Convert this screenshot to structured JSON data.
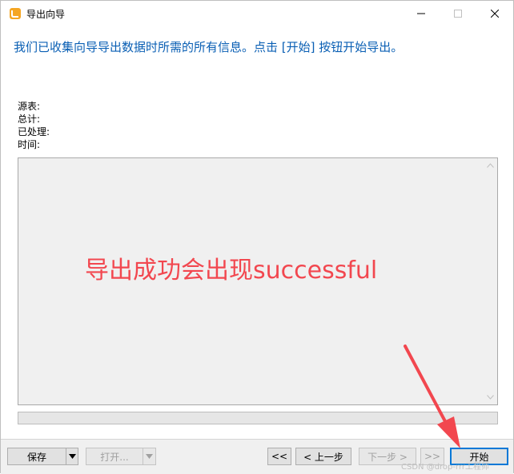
{
  "window": {
    "title": "导出向导",
    "controls": {
      "minimize": "minimize",
      "maximize": "maximize",
      "close": "close"
    }
  },
  "main": {
    "heading": "我们已收集向导导出数据时所需的所有信息。点击 [开始] 按钮开始导出。",
    "info_labels": [
      "源表:",
      "总计:",
      "已处理:",
      "时间:"
    ],
    "log_text": "导出成功会出现successful",
    "progress": 0
  },
  "footer": {
    "save_label": "保存",
    "open_label": "打开...",
    "first_label": "<<",
    "prev_label": "< 上一步",
    "next_label": "下一步 >",
    "last_label": ">>",
    "start_label": "开始"
  },
  "watermark": "CSDN @drop-rrr工程师",
  "colors": {
    "heading": "#0a5fb4",
    "annotation": "#f2474f",
    "accent": "#0078d7"
  }
}
